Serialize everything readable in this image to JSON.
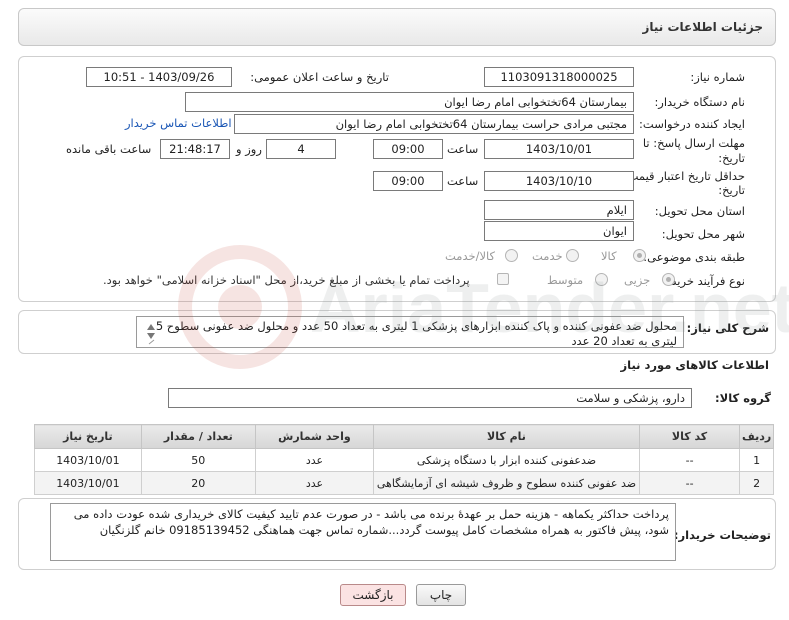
{
  "header": {
    "title": "جزئیات اطلاعات نیاز"
  },
  "form": {
    "need_number_label": "شماره نیاز:",
    "need_number": "1103091318000025",
    "announce_label": "تاریخ و ساعت اعلان عمومی:",
    "announce_value": "1403/09/26 - 10:51",
    "buyer_org_label": "نام دستگاه خریدار:",
    "buyer_org": "بیمارستان 64تختخوابی امام رضا ایوان",
    "requester_label": "ایجاد کننده درخواست:",
    "requester": "مجتبی مرادی حراست بیمارستان 64تختخوابی امام رضا ایوان",
    "contact_link": "اطلاعات تماس خریدار",
    "deadline_label_1": "مهلت ارسال پاسخ: تا",
    "deadline_label_2": "تاریخ:",
    "deadline_date": "1403/10/01",
    "time_label": "ساعت",
    "deadline_time": "09:00",
    "days_value": "4",
    "days_label": "روز و",
    "remaining_time": "21:48:17",
    "remaining_label": "ساعت باقی مانده",
    "validity_label_1": "حداقل تاریخ اعتبار قیمت: تا",
    "validity_label_2": "تاریخ:",
    "validity_date": "1403/10/10",
    "validity_time": "09:00",
    "province_label": "استان محل تحویل:",
    "province": "ایلام",
    "city_label": "شهر محل تحویل:",
    "city": "ایوان",
    "category_label": "طبقه بندی موضوعی:",
    "category_options": [
      "کالا",
      "خدمت",
      "کالا/خدمت"
    ],
    "category_selected": "کالا",
    "process_label": "نوع فرآیند خرید :",
    "process_options": [
      "جزیی",
      "متوسط"
    ],
    "process_selected": "جزیی",
    "payment_note": "پرداخت تمام یا بخشی از مبلغ خرید،از محل \"اسناد خزانه اسلامی\" خواهد بود."
  },
  "description": {
    "label": "شرح کلی نیاز:",
    "text": "محلول ضد عفونی کننده و پاک کننده ابزارهای پزشکی 1 لیتری به تعداد 50 عدد و محلول ضد عفونی سطوح 5 لیتری به تعداد 20 عدد"
  },
  "goods": {
    "section_title": "اطلاعات کالاهای مورد نیاز",
    "group_label": "گروه کالا:",
    "group_value": "دارو، پزشکی و سلامت",
    "columns": [
      "ردیف",
      "کد کالا",
      "نام کالا",
      "واحد شمارش",
      "تعداد / مقدار",
      "تاریخ نیاز"
    ],
    "rows": [
      {
        "row": "1",
        "code": "--",
        "name": "ضدعفونی کننده ابزار با دستگاه پزشکی",
        "unit": "عدد",
        "qty": "50",
        "date": "1403/10/01"
      },
      {
        "row": "2",
        "code": "--",
        "name": "ضد عفونی کننده سطوح و ظروف شیشه ای آزمایشگاهی",
        "unit": "عدد",
        "qty": "20",
        "date": "1403/10/01"
      }
    ]
  },
  "buyer_notes": {
    "label": "توضیحات خریدار:",
    "text": "پرداخت حداکثر یکماهه - هزینه حمل بر عهدهٔ برنده می باشد - در صورت عدم تایید کیفیت کالای خریداری شده عودت داده می شود، پیش فاکتور به همراه مشخصات کامل پیوست گردد...شماره تماس جهت هماهنگی 09185139452 خانم گلزنگیان"
  },
  "buttons": {
    "print": "چاپ",
    "back": "بازگشت"
  },
  "watermark": {
    "text": "AriaTender.net"
  },
  "colors": {
    "link": "#1a56b5",
    "back_button_bg": "#fbe3e3",
    "watermark": "#c0392b"
  }
}
